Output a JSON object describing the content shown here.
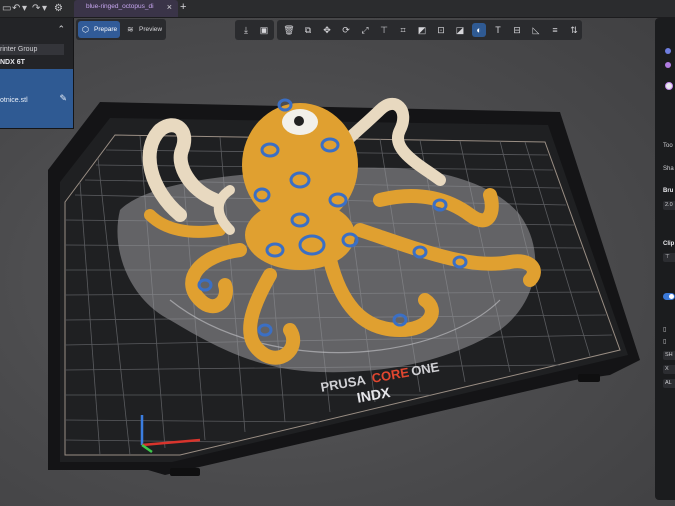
{
  "tab": {
    "title": "blue-ringed_octopus_di",
    "close": "×",
    "add": "+"
  },
  "sidebar": {
    "collapse_icon": "⌃",
    "group_label": "rinter Group",
    "printer_name": "NDX 6T",
    "object_file": "otnice.stl"
  },
  "modes": {
    "prepare": "Prepare",
    "preview": "Preview"
  },
  "right_panel": {
    "tool_label": "Too",
    "shape_label": "Sha",
    "brush_label": "Bru",
    "brush_value": "2.0",
    "clip_label": "Clip",
    "buttons": [
      "SH",
      "X",
      "AL"
    ]
  },
  "bed": {
    "brand": "PRUSA",
    "model_a": "CORE",
    "model_b": "ONE",
    "sub": "INDX"
  },
  "colors": {
    "accent": "#2f5a93",
    "tab_text": "#c7a6f0",
    "octopus_body": "#e0a030",
    "ring_blue": "#3b6fc4"
  }
}
